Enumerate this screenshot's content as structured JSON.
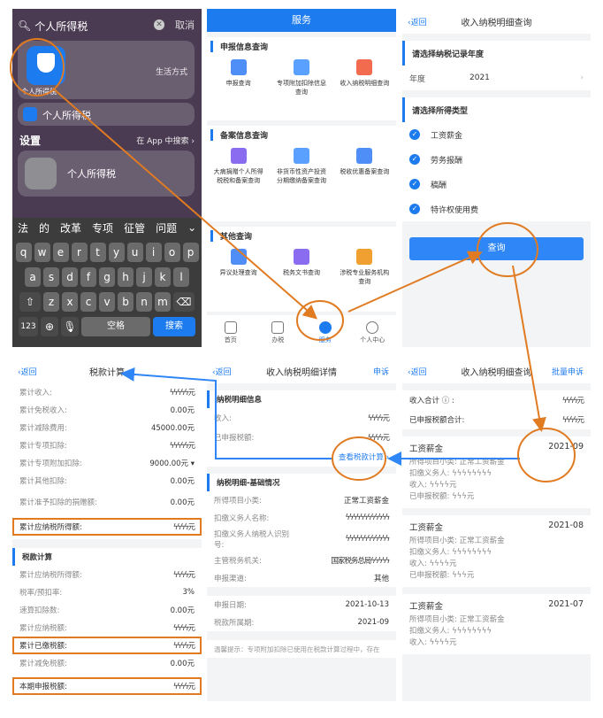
{
  "p1": {
    "search_query": "个人所得税",
    "cancel": "取消",
    "top_app_name": "个人所得税",
    "top_app_category": "生活方式",
    "app_row_label": "个人所得税",
    "settings_header": "设置",
    "settings_in_app": "在 App 中搜索 ›",
    "settings_item": "个人所得税",
    "candidates": [
      "法",
      "的",
      "改革",
      "专项",
      "征管",
      "问题",
      "⌄"
    ],
    "row1": [
      "q",
      "w",
      "e",
      "r",
      "t",
      "y",
      "u",
      "i",
      "o",
      "p"
    ],
    "row2": [
      "a",
      "s",
      "d",
      "f",
      "g",
      "h",
      "j",
      "k",
      "l"
    ],
    "row3": [
      "z",
      "x",
      "c",
      "v",
      "b",
      "n",
      "m"
    ],
    "key_123": "123",
    "key_space": "空格",
    "key_search": "搜索"
  },
  "p2": {
    "title": "服务",
    "sec1": "申报信息查询",
    "sec1_items": [
      "申报查询",
      "专项附加扣除信息查询",
      "收入纳税明细查询"
    ],
    "sec2": "备案信息查询",
    "sec2_items": [
      "大病捐赠个人所得税税和备案查询",
      "非货币性资产投资分期缴纳备案查询",
      "税收优惠备案查询"
    ],
    "sec3": "其他查询",
    "sec3_items": [
      "异议处理查询",
      "税务文书查询",
      "涉税专业服务机构查询"
    ],
    "tabs": [
      "首页",
      "办税",
      "服务",
      "个人中心"
    ]
  },
  "p3": {
    "back": "‹返回",
    "title": "收入纳税明细查询",
    "year_header": "请选择纳税记录年度",
    "year_label": "年度",
    "year_value": "2021",
    "type_header": "请选择所得类型",
    "types": [
      "工资薪金",
      "劳务报酬",
      "稿酬",
      "特许权使用费"
    ],
    "query_button": "查询"
  },
  "p4": {
    "back": "‹返回",
    "title": "税款计算",
    "rows1": [
      {
        "k": "累计收入:",
        "v": "ϟϟϟϟϟ元"
      },
      {
        "k": "累计免税收入:",
        "v": "0.00元"
      },
      {
        "k": "累计减除费用:",
        "v": "45000.00元"
      },
      {
        "k": "累计专项扣除:",
        "v": "ϟϟϟϟϟ元"
      },
      {
        "k": "累计专项附加扣除:",
        "v": "9000.00元 ▾"
      },
      {
        "k": "累计其他扣除:",
        "v": "0.00元"
      },
      {
        "k": "累计准予扣除的捐赠额:",
        "v": "0.00元"
      }
    ],
    "taxable": {
      "k": "累计应纳税所得额:",
      "v": "ϟϟϟϟ元"
    },
    "sec2": "税款计算",
    "rows2": [
      {
        "k": "累计应纳税所得额:",
        "v": "ϟϟϟϟ元"
      },
      {
        "k": "税率/预扣率:",
        "v": "3%"
      },
      {
        "k": "速算扣除数:",
        "v": "0.00元"
      },
      {
        "k": "累计应纳税额:",
        "v": "ϟϟϟϟ元"
      }
    ],
    "paid": {
      "k": "累计已缴税额:",
      "v": "ϟϟϟϟ元"
    },
    "relief": {
      "k": "累计减免税额:",
      "v": "0.00元"
    },
    "current": {
      "k": "本期申报税额:",
      "v": "ϟϟϟϟ元"
    }
  },
  "p5": {
    "back": "‹返回",
    "title": "收入纳税明细详情",
    "right": "申诉",
    "sec1": "纳税明细信息",
    "income_k": "收入:",
    "income_v": "ϟϟϟϟ元",
    "declared_k": "已申报税额:",
    "declared_v": "ϟϟϟϟ元",
    "view_calc": "查看税款计算 ›",
    "sec2": "纳税明细-基础情况",
    "basic": [
      {
        "k": "所得项目小类:",
        "v": "正常工资薪金"
      },
      {
        "k": "扣缴义务人名称:",
        "v": "ϟϟϟϟϟϟϟϟϟϟϟϟ"
      },
      {
        "k": "扣缴义务人纳税人识别号:",
        "v": "ϟϟϟϟϟϟϟϟϟϟϟϟ"
      },
      {
        "k": "主管税务机关:",
        "v": "国家税务总局ϟϟϟϟϟ"
      },
      {
        "k": "申报渠道:",
        "v": "其他"
      }
    ],
    "dates": [
      {
        "k": "申报日期:",
        "v": "2021-10-13"
      },
      {
        "k": "税款所属期:",
        "v": "2021-09"
      }
    ],
    "tip": "温馨提示：专项附加扣除已使用在税款计算过程中，存在"
  },
  "p6": {
    "back": "‹返回",
    "title": "收入纳税明细查询",
    "right": "批量申诉",
    "total_income_k": "收入合计 ⓘ :",
    "total_income_v": "ϟϟϟϟ元",
    "total_tax_k": "已申报税额合计:",
    "total_tax_v": "ϟϟϟϟ元",
    "items": [
      {
        "type": "工资薪金",
        "period": "2021-09",
        "sub": "所得项目小类: 正常工资薪金",
        "agent": "扣缴义务人: ϟϟϟϟϟϟϟϟ",
        "income": "收入: ϟϟϟϟ元",
        "tax": "已申报税额: ϟϟϟ元"
      },
      {
        "type": "工资薪金",
        "period": "2021-08",
        "sub": "所得项目小类: 正常工资薪金",
        "agent": "扣缴义务人: ϟϟϟϟϟϟϟϟ",
        "income": "收入: ϟϟϟϟ元",
        "tax": "已申报税额: ϟϟϟ元"
      },
      {
        "type": "工资薪金",
        "period": "2021-07",
        "sub": "所得项目小类: 正常工资薪金",
        "agent": "扣缴义务人: ϟϟϟϟϟϟϟϟ",
        "income": "收入: ϟϟϟϟ元",
        "tax": ""
      }
    ]
  },
  "colors": {
    "accent": "#1d7bf0",
    "highlight": "#e07b22"
  }
}
